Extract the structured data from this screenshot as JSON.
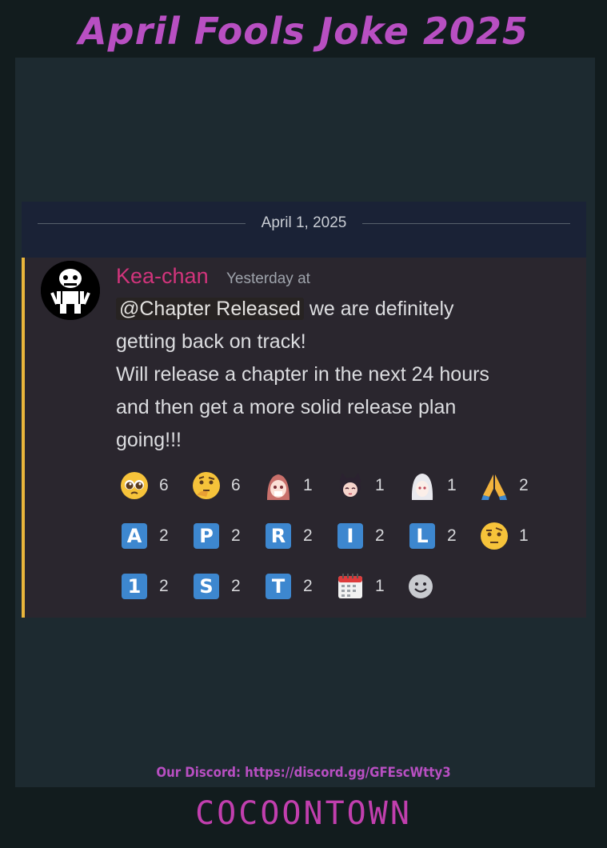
{
  "header": {
    "title": "April Fools Joke 2025"
  },
  "colors": {
    "title": "#b84fc2",
    "author": "#d2347c",
    "accent_bar": "#e9b53b",
    "brand": "#c13fae",
    "link": "#b84fc2"
  },
  "chat": {
    "date_divider": "April 1, 2025",
    "message": {
      "author": "Kea-chan",
      "timestamp": "Yesterday at",
      "mention": "@Chapter Released",
      "lines": [
        "we are definitely",
        "getting back on track!",
        "Will release a chapter in the next 24 hours",
        "and then get a more solid release plan",
        "going!!!"
      ]
    },
    "reactions": [
      [
        {
          "emoji": "pleading-face",
          "count": "6"
        },
        {
          "emoji": "thinking-face",
          "count": "6"
        },
        {
          "emoji": "anime-pink-hair-sticker",
          "count": "1"
        },
        {
          "emoji": "anime-cat-ears-sticker",
          "count": "1"
        },
        {
          "emoji": "anime-white-hair-sticker",
          "count": "1"
        },
        {
          "emoji": "folded-hands",
          "count": "2"
        }
      ],
      [
        {
          "emoji": "regional-a",
          "letter": "A",
          "count": "2"
        },
        {
          "emoji": "regional-p",
          "letter": "P",
          "count": "2"
        },
        {
          "emoji": "regional-r",
          "letter": "R",
          "count": "2"
        },
        {
          "emoji": "regional-i",
          "letter": "I",
          "count": "2"
        },
        {
          "emoji": "regional-l",
          "letter": "L",
          "count": "2"
        },
        {
          "emoji": "raised-eyebrow-face",
          "count": "1"
        }
      ],
      [
        {
          "emoji": "keycap-1",
          "letter": "1",
          "count": "2"
        },
        {
          "emoji": "regional-s",
          "letter": "S",
          "count": "2"
        },
        {
          "emoji": "regional-t",
          "letter": "T",
          "count": "2"
        },
        {
          "emoji": "calendar",
          "count": "1"
        },
        {
          "emoji": "add-reaction",
          "count": ""
        }
      ]
    ]
  },
  "footer": {
    "discord_link": "Our Discord: https://discord.gg/GFEscWtty3",
    "brand": "COCOONTOWN"
  }
}
